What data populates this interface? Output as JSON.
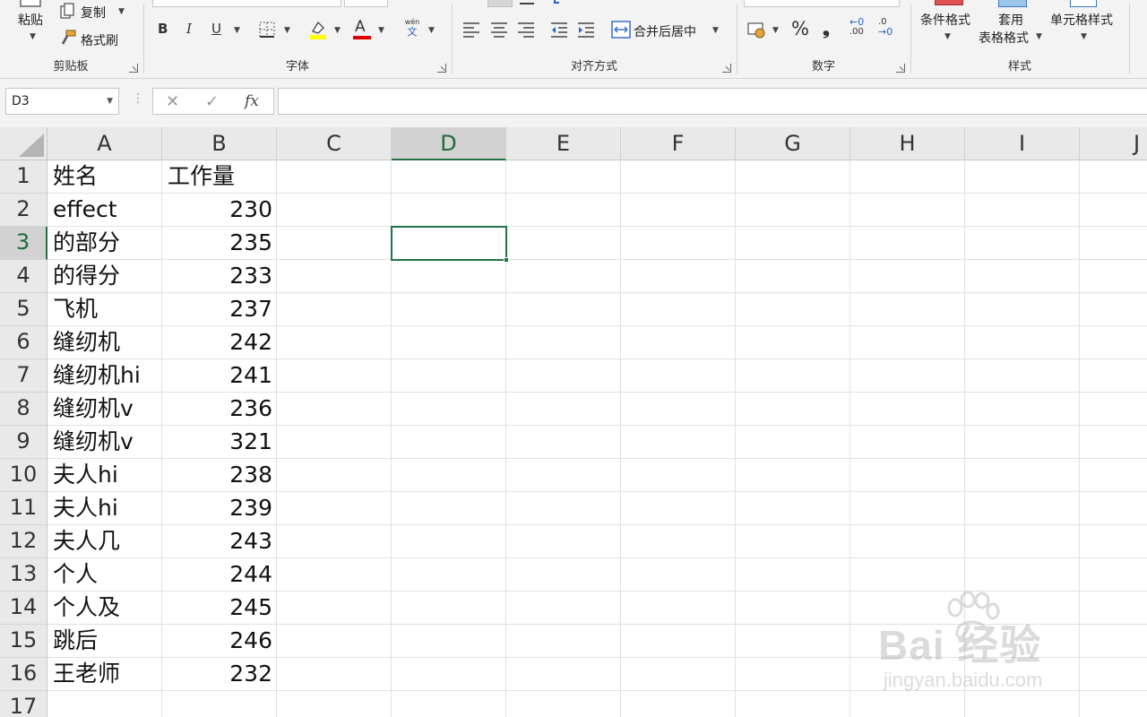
{
  "ribbon": {
    "clipboard": {
      "paste_label": "粘贴",
      "copy_label": "复制",
      "format_painter_label": "格式刷",
      "group_label": "剪贴板"
    },
    "font": {
      "bold_label": "B",
      "italic_label": "I",
      "underline_label": "U",
      "font_color_label": "A",
      "phonetic_top": "wén",
      "phonetic_bottom": "文",
      "group_label": "字体",
      "highlight_color": "#ffff00",
      "font_color": "#e00000"
    },
    "alignment": {
      "merge_label": "合并后居中",
      "group_label": "对齐方式"
    },
    "number": {
      "percent_label": "%",
      "comma_label": "❟",
      "inc_decimal_label": ".00",
      "dec_decimal_label": ".0",
      "group_label": "数字"
    },
    "styles": {
      "conditional_label": "条件格式",
      "table_label_line1": "套用",
      "table_label_line2": "表格格式",
      "cell_styles_label": "单元格样式",
      "group_label": "样式"
    }
  },
  "formula_bar": {
    "name_box": "D3",
    "cancel_label": "✕",
    "enter_label": "✓",
    "fx_label": "fx",
    "value": ""
  },
  "sheet": {
    "columns": [
      "A",
      "B",
      "C",
      "D",
      "E",
      "F",
      "G",
      "H",
      "I",
      "J"
    ],
    "row_numbers": [
      "1",
      "2",
      "3",
      "4",
      "5",
      "6",
      "7",
      "8",
      "9",
      "10",
      "11",
      "12",
      "13",
      "14",
      "15",
      "16",
      "17"
    ],
    "selected_column": "D",
    "selected_row": "3",
    "rows": [
      {
        "a": "姓名",
        "b": "工作量"
      },
      {
        "a": "effect",
        "b": "230"
      },
      {
        "a": "的部分",
        "b": "235"
      },
      {
        "a": "的得分",
        "b": "233"
      },
      {
        "a": "飞机",
        "b": "237"
      },
      {
        "a": "缝纫机",
        "b": "242"
      },
      {
        "a": "缝纫机hi",
        "b": "241"
      },
      {
        "a": "缝纫机v",
        "b": "236"
      },
      {
        "a": "缝纫机v",
        "b": "321"
      },
      {
        "a": "夫人hi",
        "b": "238"
      },
      {
        "a": "夫人hi",
        "b": "239"
      },
      {
        "a": "夫人几",
        "b": "243"
      },
      {
        "a": "个人",
        "b": "244"
      },
      {
        "a": "个人及",
        "b": "245"
      },
      {
        "a": "跳后",
        "b": "246"
      },
      {
        "a": "王老师",
        "b": "232"
      }
    ]
  },
  "watermark": {
    "brand": "Bai 经验",
    "url": "jingyan.baidu.com"
  },
  "colors": {
    "accent": "#217346",
    "ribbon_bg": "#f3f3f3",
    "header_bg": "#e9e9e9"
  }
}
